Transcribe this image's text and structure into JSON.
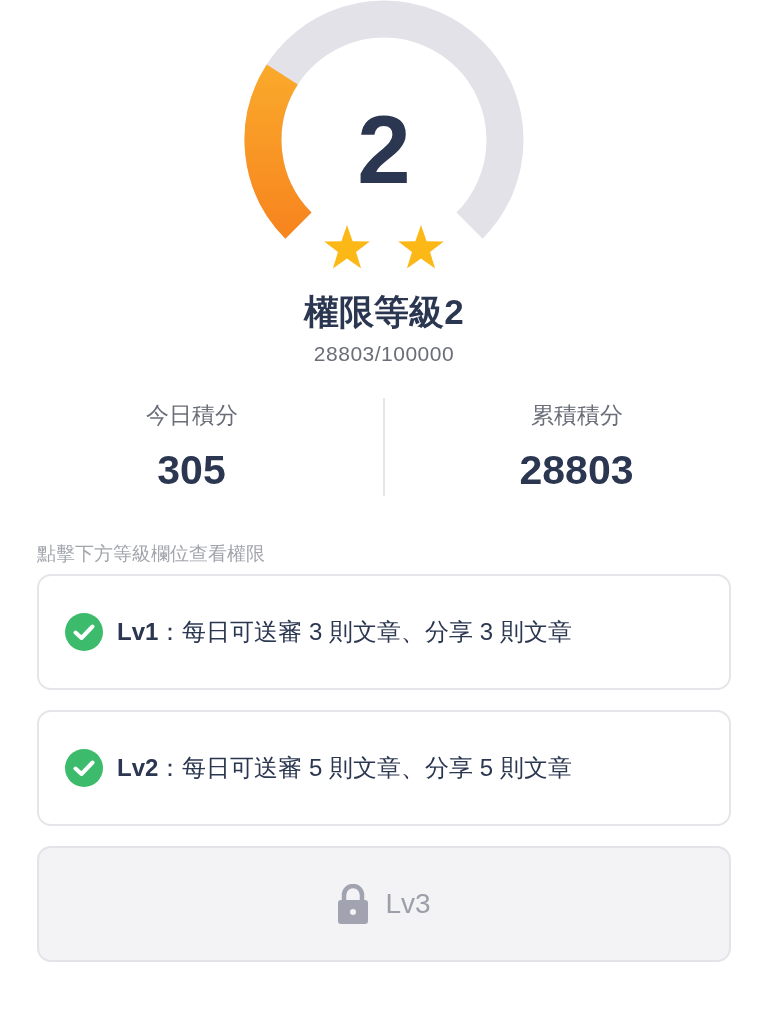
{
  "gauge": {
    "value": "2",
    "icons": [
      {
        "kind": "star"
      },
      {
        "kind": "star"
      }
    ]
  },
  "title": "權限等級2",
  "progress": "28803/100000",
  "stats": [
    {
      "label": "今日積分",
      "value": "305"
    },
    {
      "label": "累積積分",
      "value": "28803"
    }
  ],
  "hint": "點擊下方等級欄位查看權限",
  "levels": [
    {
      "text": "**Lv1**：每日可送審 3 則文章、分享 3 則文章",
      "locked": false
    },
    {
      "text": "**Lv2**：每日可送審 5 則文章、分享 5 則文章",
      "locked": false
    },
    {
      "text": "Lv3",
      "locked": true
    }
  ]
}
